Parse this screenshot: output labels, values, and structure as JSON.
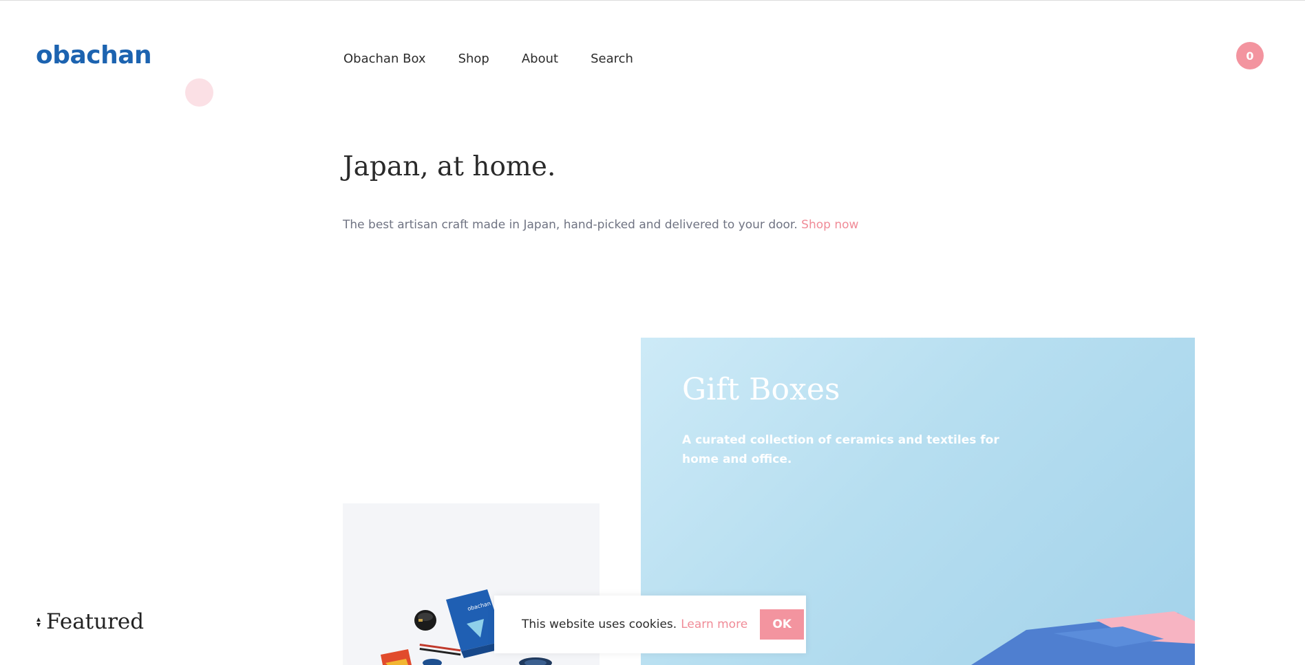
{
  "header": {
    "logo": "obachan",
    "nav": [
      {
        "label": "Obachan Box"
      },
      {
        "label": "Shop"
      },
      {
        "label": "About"
      },
      {
        "label": "Search"
      }
    ],
    "cart_count": "0"
  },
  "hero": {
    "title": "Japan, at home.",
    "subtitle": "The best artisan craft made in Japan, hand-picked and delivered to your door.",
    "cta": "Shop now"
  },
  "gift_boxes": {
    "title": "Gift Boxes",
    "description": "A curated collection of ceramics and textiles for home and office."
  },
  "product_card": {
    "box_label": "obachan"
  },
  "featured": {
    "label": "Featured"
  },
  "cookie_banner": {
    "text": "This website uses cookies.",
    "link": "Learn more",
    "button": "OK"
  },
  "colors": {
    "brand_blue": "#1c63b0",
    "accent_pink": "#f3949f",
    "link_pink": "#f08b97",
    "sky_blue": "#b6def0"
  }
}
